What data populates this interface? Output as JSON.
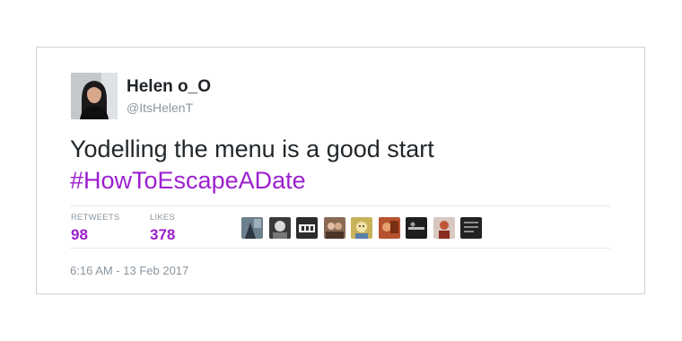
{
  "tweet": {
    "author": {
      "display_name": "Helen o_O",
      "handle": "@ItsHelenT",
      "avatar_icon": "profile-photo"
    },
    "text_line": "Yodelling the menu is a good start",
    "hashtag": "#HowToEscapeADate",
    "stats": {
      "retweets_label": "RETWEETS",
      "retweets_count": "98",
      "likes_label": "LIKES",
      "likes_count": "378"
    },
    "likers": [
      {
        "avatar_icon": "liker-avatar-1",
        "color": "#6b7f8c"
      },
      {
        "avatar_icon": "liker-avatar-2",
        "color": "#3a3a3a"
      },
      {
        "avatar_icon": "liker-avatar-3",
        "color": "#2b2b2b"
      },
      {
        "avatar_icon": "liker-avatar-4",
        "color": "#8a6a55"
      },
      {
        "avatar_icon": "liker-avatar-5",
        "color": "#c9b25a"
      },
      {
        "avatar_icon": "liker-avatar-6",
        "color": "#b5532e"
      },
      {
        "avatar_icon": "liker-avatar-7",
        "color": "#1e1e1e"
      },
      {
        "avatar_icon": "liker-avatar-8",
        "color": "#d8c8c0"
      },
      {
        "avatar_icon": "liker-avatar-9",
        "color": "#222222"
      }
    ],
    "timestamp": "6:16 AM - 13 Feb 2017"
  },
  "colors": {
    "accent": "#9b1fcf",
    "muted_text": "#8a96a0",
    "card_border": "#c9d3da"
  }
}
